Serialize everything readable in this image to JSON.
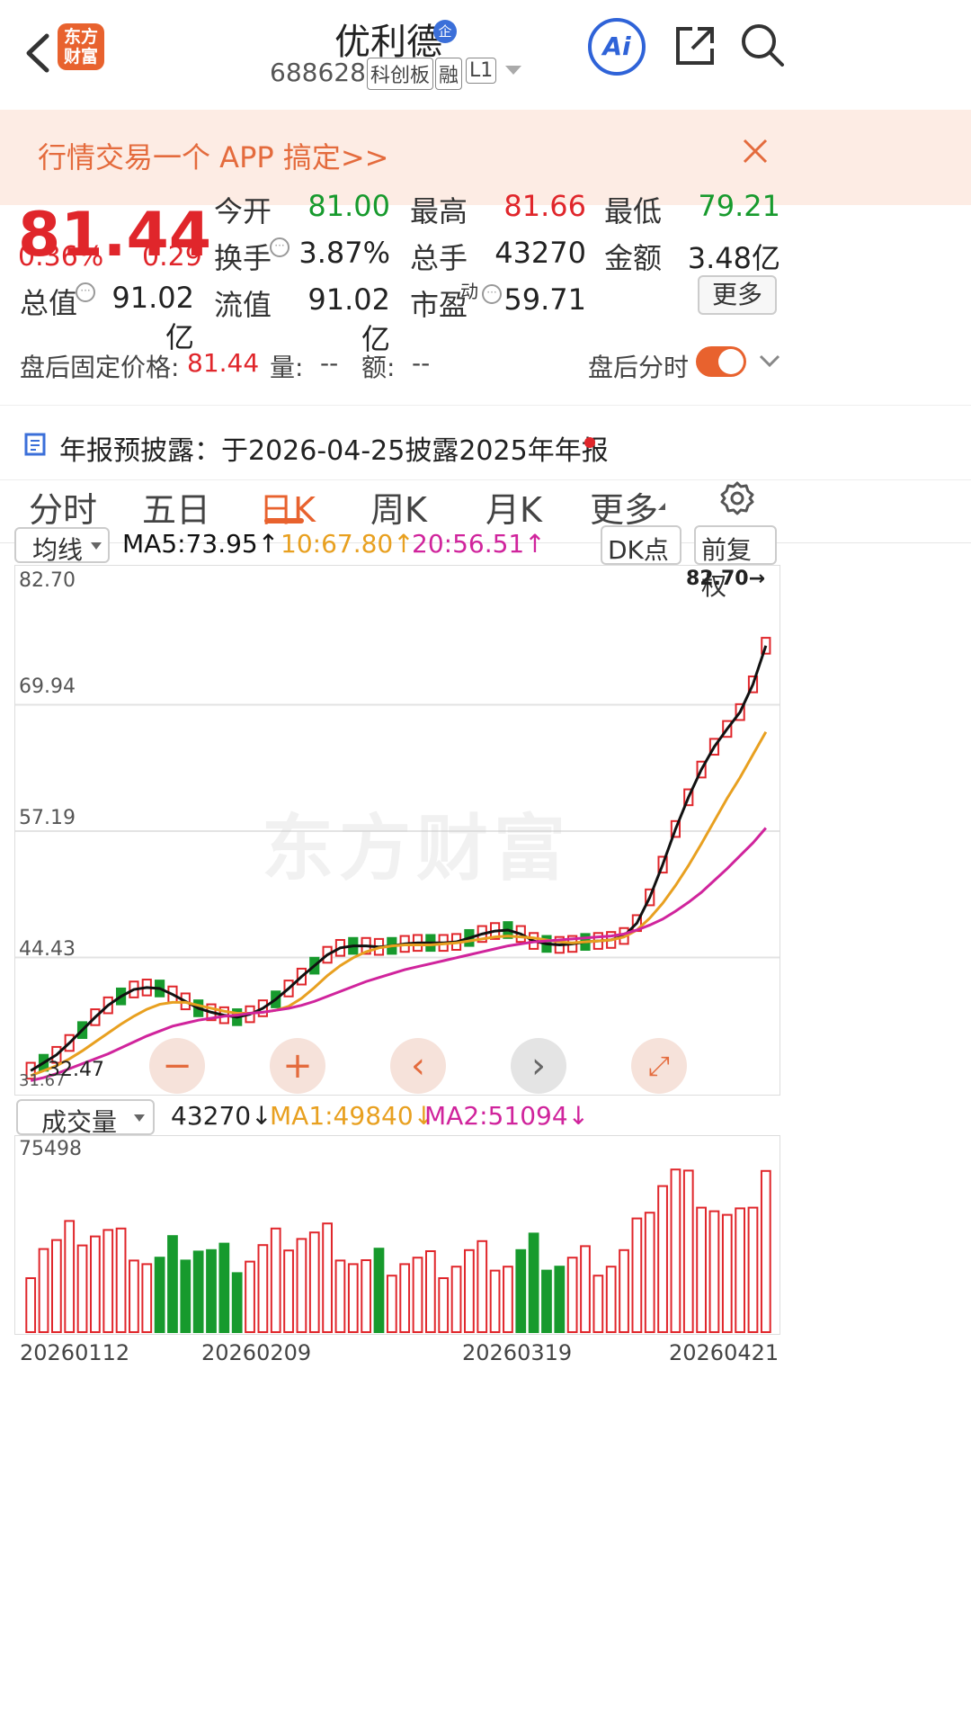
{
  "header": {
    "logo_text_line1": "东方",
    "logo_text_line2": "财富",
    "stock_name": "优利德",
    "enterprise_badge": "企",
    "stock_code": "688628",
    "tags": [
      "科创板",
      "融",
      "L1"
    ],
    "ai_label": "Ai"
  },
  "banner": {
    "text": "行情交易一个 APP 搞定>>"
  },
  "quote": {
    "price": "81.44",
    "change_pct": "0.36%",
    "change": "0.29",
    "total_value_label": "总值",
    "total_value": "91.02亿",
    "open_label": "今开",
    "open": "81.00",
    "high_label": "最高",
    "high": "81.66",
    "low_label": "最低",
    "low": "79.21",
    "turnover_label": "换手",
    "turnover": "3.87%",
    "volume_label": "总手",
    "volume": "43270",
    "amount_label": "金额",
    "amount": "3.48亿",
    "float_label": "流值",
    "float_value": "91.02亿",
    "pe_label": "市盈",
    "pe_super": "动",
    "pe": "59.71",
    "more_button": "更多"
  },
  "after_hours": {
    "label": "盘后固定价格:",
    "price": "81.44",
    "qty_label": "量:",
    "qty": "--",
    "amt_label": "额:",
    "amt": "--",
    "toggle_label": "盘后分时",
    "toggle_on": true
  },
  "notice": {
    "text": "年报预披露：于2026-04-25披露2025年年报"
  },
  "tabs": [
    "分时",
    "五日",
    "日K",
    "周K",
    "月K",
    "更多"
  ],
  "active_tab": "日K",
  "ma_row": {
    "selector": "均线",
    "ma5": "MA5:73.95↑",
    "ma10": "10:67.80↑",
    "ma20": "20:56.51↑",
    "dk_button": "DK点",
    "adjust_button": "前复权"
  },
  "vol_row": {
    "selector": "成交量",
    "vol": "43270↓",
    "ma1": "MA1:49840↓",
    "ma2": "MA2:51094↓"
  },
  "watermark": "东方财富",
  "colors": {
    "up": "#e0262b",
    "down": "#179a2d",
    "ma5": "#111111",
    "ma10": "#e8a020",
    "ma20": "#d0249c",
    "accent": "#e8622e"
  },
  "chart_data": [
    {
      "type": "candlestick",
      "title": "",
      "y_ticks": [
        "82.70",
        "69.94",
        "57.19",
        "44.43",
        "31.67"
      ],
      "ylim": [
        31.67,
        82.7
      ],
      "max_marker": "82.70→",
      "min_marker": "32.47",
      "series": [
        {
          "name": "MA5",
          "values": [
            33.0,
            33.8,
            34.6,
            35.8,
            37.1,
            38.4,
            39.6,
            40.5,
            41.2,
            41.4,
            41.3,
            40.7,
            40.0,
            39.3,
            38.9,
            38.6,
            38.4,
            38.7,
            39.3,
            40.2,
            41.3,
            42.5,
            43.6,
            44.7,
            45.4,
            45.6,
            45.6,
            45.5,
            45.6,
            45.8,
            45.9,
            45.9,
            45.9,
            46.0,
            46.4,
            46.8,
            47.1,
            47.2,
            46.8,
            46.1,
            45.8,
            45.7,
            45.8,
            46.0,
            46.1,
            46.2,
            46.6,
            47.9,
            50.5,
            53.8,
            57.4,
            60.6,
            63.4,
            65.7,
            67.5,
            69.2,
            72.0,
            75.9
          ]
        },
        {
          "name": "10",
          "values": [
            32.5,
            33.0,
            33.5,
            34.2,
            35.0,
            35.9,
            36.8,
            37.7,
            38.5,
            39.2,
            39.7,
            39.9,
            39.9,
            39.6,
            39.3,
            39.0,
            38.8,
            38.8,
            38.9,
            39.1,
            39.5,
            40.3,
            41.4,
            42.6,
            43.6,
            44.4,
            45.0,
            45.4,
            45.6,
            45.7,
            45.7,
            45.7,
            45.8,
            45.9,
            46.1,
            46.3,
            46.5,
            46.6,
            46.5,
            46.4,
            46.2,
            46.0,
            45.9,
            46.0,
            46.1,
            46.2,
            46.5,
            47.2,
            48.4,
            49.9,
            51.7,
            53.7,
            55.9,
            58.2,
            60.5,
            62.6,
            64.9,
            67.2
          ]
        },
        {
          "name": "20",
          "values": [
            32.0,
            32.3,
            32.7,
            33.2,
            33.7,
            34.2,
            34.7,
            35.3,
            35.9,
            36.5,
            37.0,
            37.5,
            37.8,
            38.1,
            38.3,
            38.5,
            38.6,
            38.8,
            38.9,
            39.1,
            39.3,
            39.6,
            40.0,
            40.5,
            41.0,
            41.5,
            42.0,
            42.4,
            42.8,
            43.2,
            43.5,
            43.8,
            44.1,
            44.4,
            44.7,
            45.0,
            45.3,
            45.6,
            45.8,
            46.0,
            46.1,
            46.2,
            46.3,
            46.4,
            46.5,
            46.6,
            46.8,
            47.2,
            47.7,
            48.3,
            49.1,
            50.0,
            51.0,
            52.2,
            53.4,
            54.7,
            56.0,
            57.5
          ]
        }
      ]
    },
    {
      "type": "bar",
      "title": "",
      "y_ticks": [
        "75498"
      ],
      "ylim": [
        0,
        78000
      ],
      "categories": [
        "20260112",
        "20260209",
        "20260319",
        "20260421"
      ],
      "series": [
        {
          "name": "MA1",
          "values": []
        },
        {
          "name": "MA2",
          "values": []
        }
      ]
    }
  ]
}
